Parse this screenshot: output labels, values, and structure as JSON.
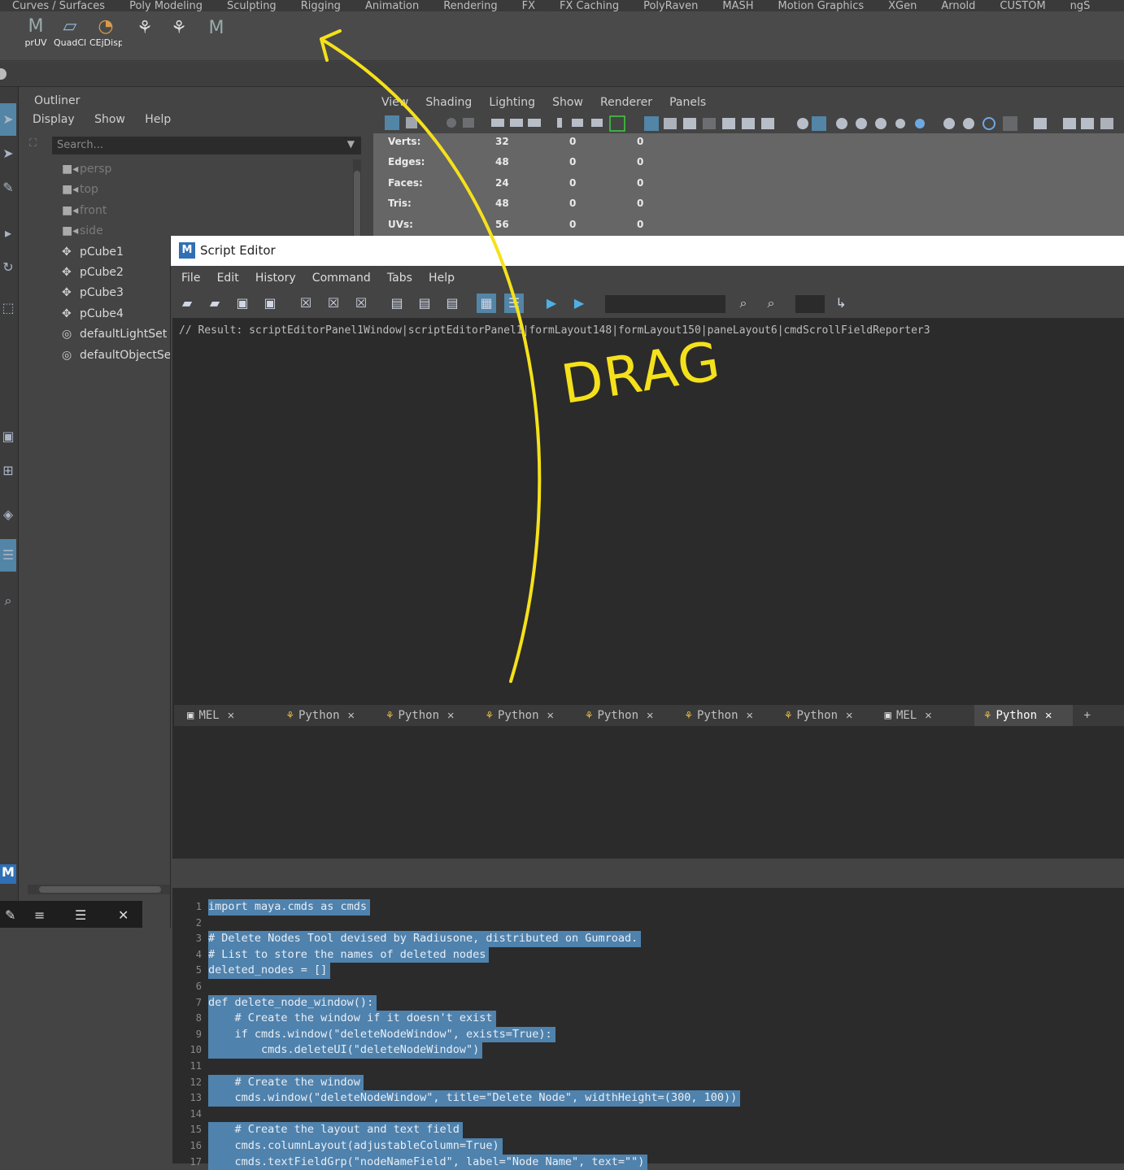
{
  "shelf": {
    "tabs": [
      "Curves / Surfaces",
      "Poly Modeling",
      "Sculpting",
      "Rigging",
      "Animation",
      "Rendering",
      "FX",
      "FX Caching",
      "PolyRaven",
      "MASH",
      "Motion Graphics",
      "XGen",
      "Arnold",
      "CUSTOM",
      "ngS"
    ],
    "buttons": [
      "prUV",
      "QuadCl",
      "CEjDisp"
    ]
  },
  "outliner": {
    "title": "Outliner",
    "menu": [
      "Display",
      "Show",
      "Help"
    ],
    "search_placeholder": "Search...",
    "items": [
      {
        "label": "persp",
        "icon": "camera-icon",
        "dimmed": true
      },
      {
        "label": "top",
        "icon": "camera-icon",
        "dimmed": true
      },
      {
        "label": "front",
        "icon": "camera-icon",
        "dimmed": true
      },
      {
        "label": "side",
        "icon": "camera-icon",
        "dimmed": true
      },
      {
        "label": "pCube1",
        "icon": "transform-icon",
        "dimmed": false
      },
      {
        "label": "pCube2",
        "icon": "transform-icon",
        "dimmed": false
      },
      {
        "label": "pCube3",
        "icon": "transform-icon",
        "dimmed": false
      },
      {
        "label": "pCube4",
        "icon": "transform-icon",
        "dimmed": false
      },
      {
        "label": "defaultLightSet",
        "icon": "set-icon",
        "dimmed": false
      },
      {
        "label": "defaultObjectSet",
        "icon": "set-icon",
        "dimmed": false
      }
    ]
  },
  "viewport": {
    "menu": [
      "View",
      "Shading",
      "Lighting",
      "Show",
      "Renderer",
      "Panels"
    ],
    "hud": [
      {
        "label": "Verts:",
        "v1": "32",
        "v2": "0",
        "v3": "0"
      },
      {
        "label": "Edges:",
        "v1": "48",
        "v2": "0",
        "v3": "0"
      },
      {
        "label": "Faces:",
        "v1": "24",
        "v2": "0",
        "v3": "0"
      },
      {
        "label": "Tris:",
        "v1": "48",
        "v2": "0",
        "v3": "0"
      },
      {
        "label": "UVs:",
        "v1": "56",
        "v2": "0",
        "v3": "0"
      }
    ]
  },
  "script_editor": {
    "title": "Script Editor",
    "menu": [
      "File",
      "Edit",
      "History",
      "Command",
      "Tabs",
      "Help"
    ],
    "history_text": "// Result: scriptEditorPanel1Window|scriptEditorPanel1|formLayout148|formLayout150|paneLayout6|cmdScrollFieldReporter3",
    "tabs": [
      {
        "label": "MEL",
        "icon": "mel-icon",
        "active": false
      },
      {
        "label": "Python",
        "icon": "python-icon",
        "active": false
      },
      {
        "label": "Python",
        "icon": "python-icon",
        "active": false
      },
      {
        "label": "Python",
        "icon": "python-icon",
        "active": false
      },
      {
        "label": "Python",
        "icon": "python-icon",
        "active": false
      },
      {
        "label": "Python",
        "icon": "python-icon",
        "active": false
      },
      {
        "label": "Python",
        "icon": "python-icon",
        "active": false
      },
      {
        "label": "MEL",
        "icon": "mel-icon",
        "active": false
      },
      {
        "label": "Python",
        "icon": "python-icon",
        "active": true
      }
    ],
    "add_tab": "+",
    "code_lines": [
      "import maya.cmds as cmds",
      "",
      "# Delete Nodes Tool devised by Radiusone, distributed on Gumroad.",
      "# List to store the names of deleted nodes",
      "deleted_nodes = []",
      "",
      "def delete_node_window():",
      "    # Create the window if it doesn't exist",
      "    if cmds.window(\"deleteNodeWindow\", exists=True):",
      "        cmds.deleteUI(\"deleteNodeWindow\")",
      "",
      "    # Create the window",
      "    cmds.window(\"deleteNodeWindow\", title=\"Delete Node\", widthHeight=(300, 100))",
      "",
      "    # Create the layout and text field",
      "    cmds.columnLayout(adjustableColumn=True)",
      "    cmds.textFieldGrp(\"nodeNameField\", label=\"Node Name\", text=\"\")"
    ]
  },
  "annotation": {
    "text": "DRAG",
    "color": "#f5e11b"
  },
  "colors": {
    "panel": "#444444",
    "editor_bg": "#2b2b2b",
    "selection": "#4f82ad",
    "accent": "#5285a6"
  }
}
